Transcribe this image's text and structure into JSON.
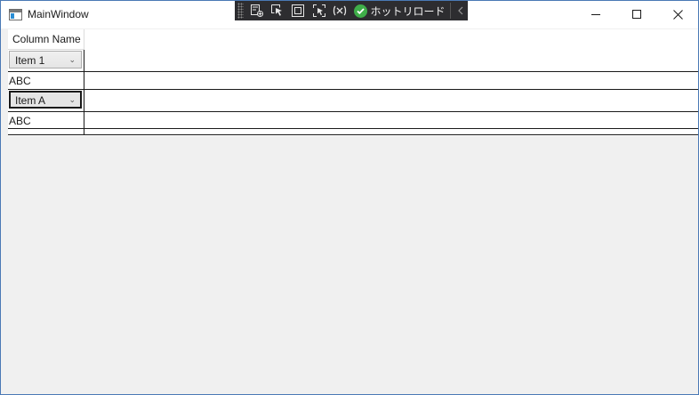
{
  "window": {
    "title": "MainWindow"
  },
  "debug_toolbar": {
    "hot_reload_label": "ホットリロード",
    "icons": [
      "select-element-icon",
      "pointer-select-icon",
      "display-layout-adorner-icon",
      "track-focus-icon",
      "binding-failures-icon"
    ]
  },
  "datagrid": {
    "column_header": "Column Name",
    "rows": [
      {
        "type": "combobox",
        "value": "Item 1",
        "focused": false
      },
      {
        "type": "text",
        "value": "ABC"
      },
      {
        "type": "combobox",
        "value": "Item A",
        "focused": true
      },
      {
        "type": "text",
        "value": "ABC"
      },
      {
        "type": "empty",
        "value": ""
      }
    ]
  },
  "colors": {
    "window_border": "#4a79b5",
    "client_bg": "#f0f0f0",
    "toolbar_bg": "#2d2d30",
    "hot_reload_check": "#3fae49"
  }
}
